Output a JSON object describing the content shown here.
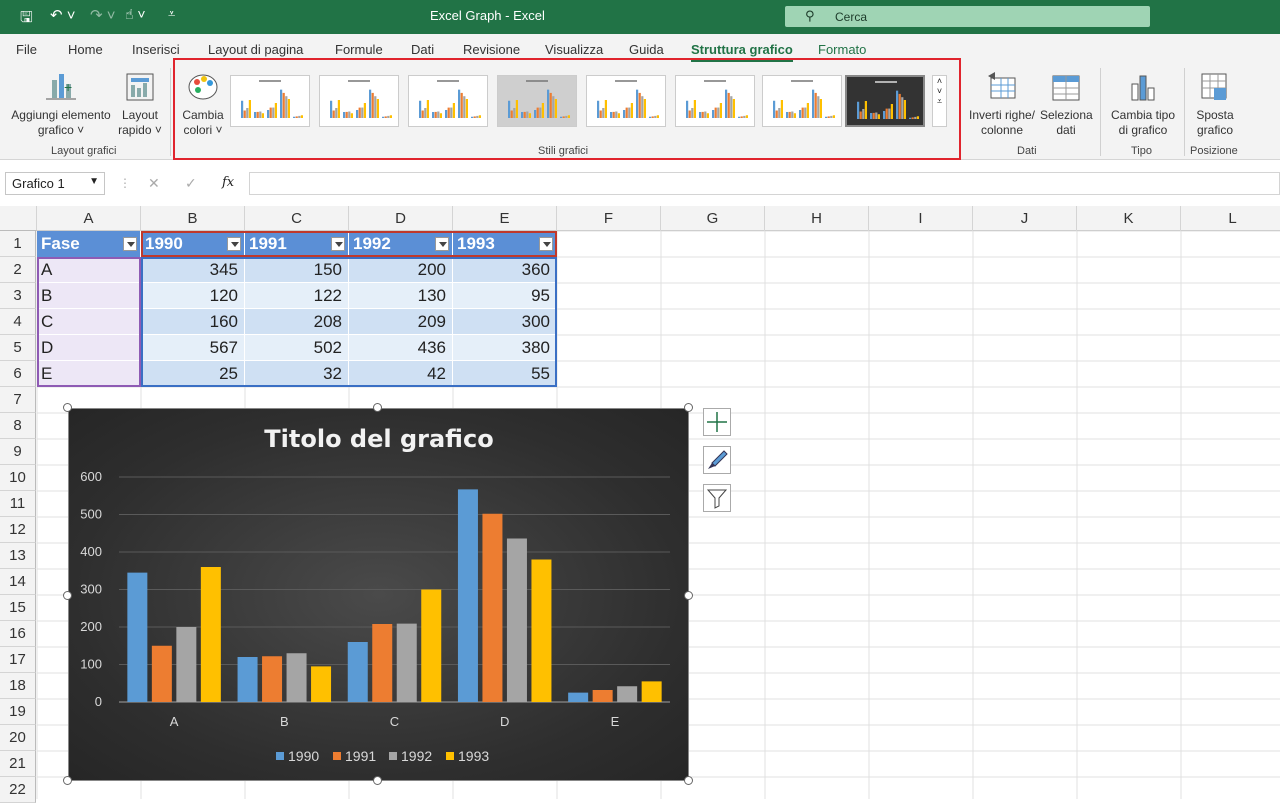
{
  "title_bar": {
    "title": "Excel Graph  -  Excel",
    "search_placeholder": "Cerca"
  },
  "menu_tabs": [
    "File",
    "Home",
    "Inserisci",
    "Layout di pagina",
    "Formule",
    "Dati",
    "Revisione",
    "Visualizza",
    "Guida",
    "Struttura grafico",
    "Formato"
  ],
  "active_tab": "Struttura grafico",
  "ribbon": {
    "add_element": {
      "line1": "Aggiungi elemento",
      "line2": "grafico ˅"
    },
    "quick_layout": {
      "line1": "Layout",
      "line2": "rapido ˅"
    },
    "group_layout": "Layout grafici",
    "change_colors": {
      "line1": "Cambia",
      "line2": "colori ˅"
    },
    "group_styles": "Stili grafici",
    "switch_row_col": {
      "line1": "Inverti righe/",
      "line2": "colonne"
    },
    "select_data": {
      "line1": "Seleziona",
      "line2": "dati"
    },
    "group_data": "Dati",
    "change_type": {
      "line1": "Cambia tipo",
      "line2": "di grafico"
    },
    "group_type": "Tipo",
    "move_chart": {
      "line1": "Sposta",
      "line2": "grafico"
    },
    "group_position": "Posizione"
  },
  "formula_bar": {
    "name_box": "Grafico 1",
    "fx": "fx",
    "cancel": "✕",
    "enter": "✓"
  },
  "columns": [
    "A",
    "B",
    "C",
    "D",
    "E",
    "F",
    "G",
    "H",
    "I",
    "J",
    "K",
    "L"
  ],
  "rows": [
    "1",
    "2",
    "3",
    "4",
    "5",
    "6",
    "7",
    "8",
    "9",
    "10",
    "11",
    "12",
    "13",
    "14",
    "15",
    "16",
    "17",
    "18",
    "19",
    "20",
    "21",
    "22"
  ],
  "table": {
    "headers": [
      "Fase",
      "1990",
      "1991",
      "1992",
      "1993"
    ],
    "rows": [
      [
        "A",
        "345",
        "150",
        "200",
        "360"
      ],
      [
        "B",
        "120",
        "122",
        "130",
        "95"
      ],
      [
        "C",
        "160",
        "208",
        "209",
        "300"
      ],
      [
        "D",
        "567",
        "502",
        "436",
        "380"
      ],
      [
        "E",
        "25",
        "32",
        "42",
        "55"
      ]
    ]
  },
  "colors": {
    "green": "#217346",
    "s1990": "#5b9bd5",
    "s1991": "#ed7d31",
    "s1992": "#a5a5a5",
    "s1993": "#ffc000"
  },
  "chart_data": {
    "type": "bar",
    "title": "Titolo del grafico",
    "categories": [
      "A",
      "B",
      "C",
      "D",
      "E"
    ],
    "series": [
      {
        "name": "1990",
        "values": [
          345,
          120,
          160,
          567,
          25
        ]
      },
      {
        "name": "1991",
        "values": [
          150,
          122,
          208,
          502,
          32
        ]
      },
      {
        "name": "1992",
        "values": [
          200,
          130,
          209,
          436,
          42
        ]
      },
      {
        "name": "1993",
        "values": [
          360,
          95,
          300,
          380,
          55
        ]
      }
    ],
    "yticks": [
      "0",
      "100",
      "200",
      "300",
      "400",
      "500",
      "600"
    ],
    "ylim": [
      0,
      600
    ],
    "grid": true,
    "legend": "bottom"
  }
}
